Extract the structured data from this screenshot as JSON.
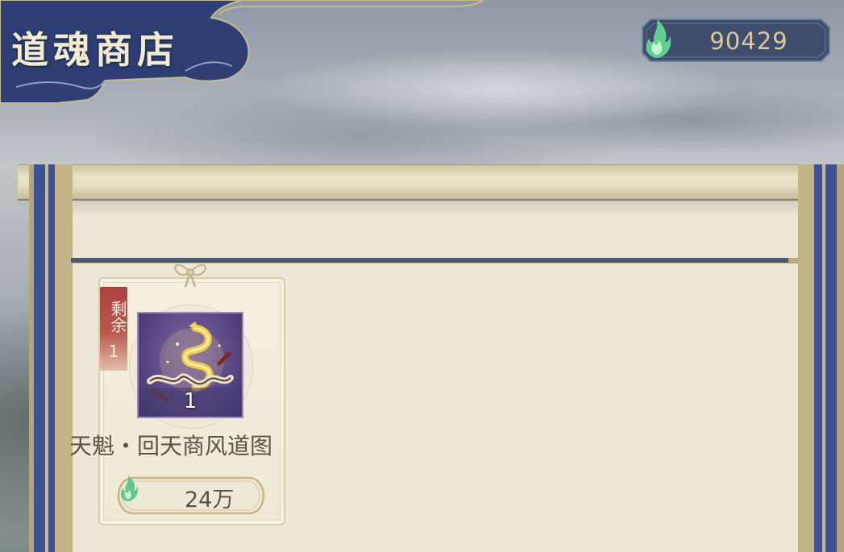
{
  "header": {
    "title": "道魂商店"
  },
  "currency": {
    "icon": "green-soul-flame-icon",
    "amount": "90429"
  },
  "shop": {
    "items": [
      {
        "remaining_label": "剩余",
        "remaining_count": "1",
        "icon": "golden-dragon-scroll-icon",
        "quantity": "1",
        "name": "天魁・回天商风道图",
        "price_icon": "green-soul-flame-icon",
        "price": "24万"
      }
    ]
  },
  "colors": {
    "banner_blue": "#2f3f75",
    "scroll_paper": "#ece7d7",
    "remain_tag_red": "#a8423d",
    "item_frame_purple": "#9a86c9",
    "currency_text": "#dcc89a"
  }
}
